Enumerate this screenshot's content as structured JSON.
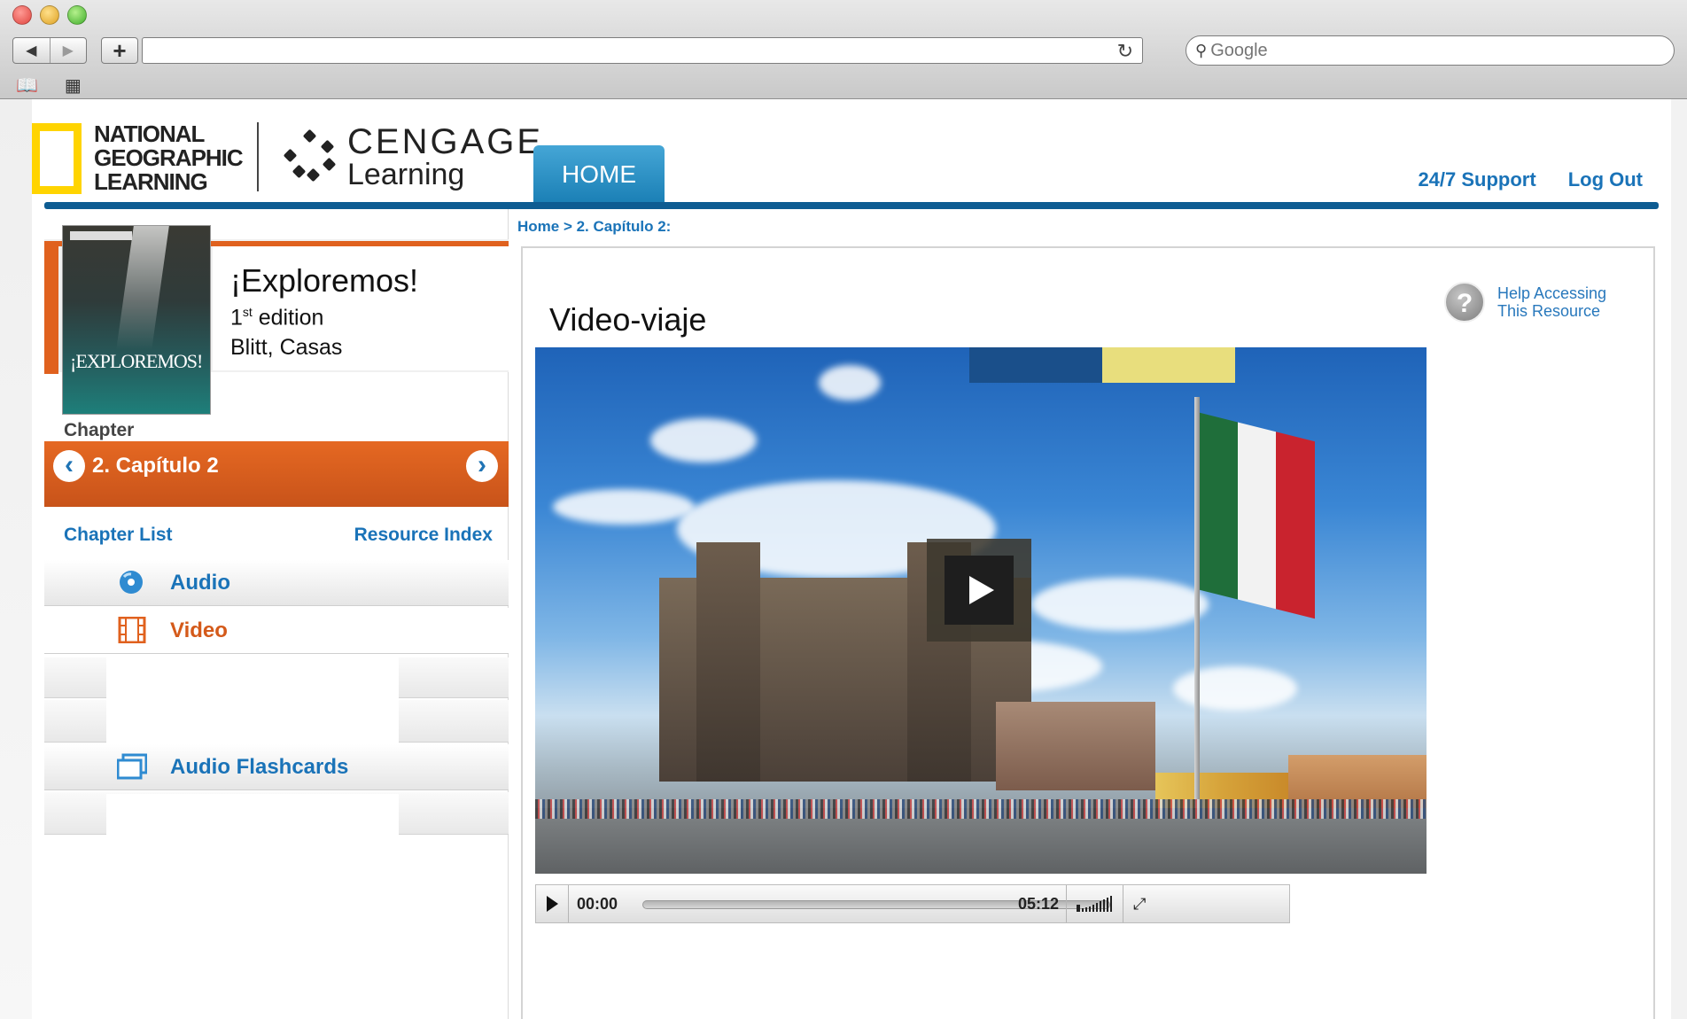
{
  "browser": {
    "search_placeholder": "Google",
    "add_label": "+",
    "back_label": "◀",
    "forward_label": "▶",
    "reload_label": "↻"
  },
  "header": {
    "ngl_logo": "NATIONAL\nGEOGRAPHIC\nLEARNING",
    "cengage_word": "CENGAGE",
    "cengage_learning": "Learning",
    "home_tab": "HOME",
    "support_link": "24/7 Support",
    "logout_link": "Log Out"
  },
  "book": {
    "title": "¡Exploremos!",
    "edition_num": "1",
    "edition_sup": "st",
    "edition_word": " edition",
    "authors": "Blitt, Casas",
    "cover_title": "¡EXPLOREMOS!"
  },
  "chapter": {
    "label": "Chapter",
    "name": "2.  Capítulo 2",
    "chapter_list": "Chapter List",
    "resource_index": "Resource Index"
  },
  "resources": [
    {
      "label": "Audio",
      "icon": "audio-disc-icon",
      "active": false
    },
    {
      "label": "Video",
      "icon": "film-icon",
      "active": true
    },
    {
      "label": "Audio Flashcards",
      "icon": "flashcards-icon",
      "active": false
    }
  ],
  "breadcrumb": "Home > 2. Capítulo 2:",
  "main": {
    "title": "Video-viaje",
    "help_line1": "Help Accessing",
    "help_line2": "This Resource"
  },
  "player": {
    "current_time": "00:00",
    "duration": "05:12",
    "progress": 0
  },
  "colors": {
    "accent_blue": "#1a73b8",
    "orange": "#e0611e",
    "header_bar": "#0d5c92",
    "ngl_yellow": "#ffd400"
  }
}
